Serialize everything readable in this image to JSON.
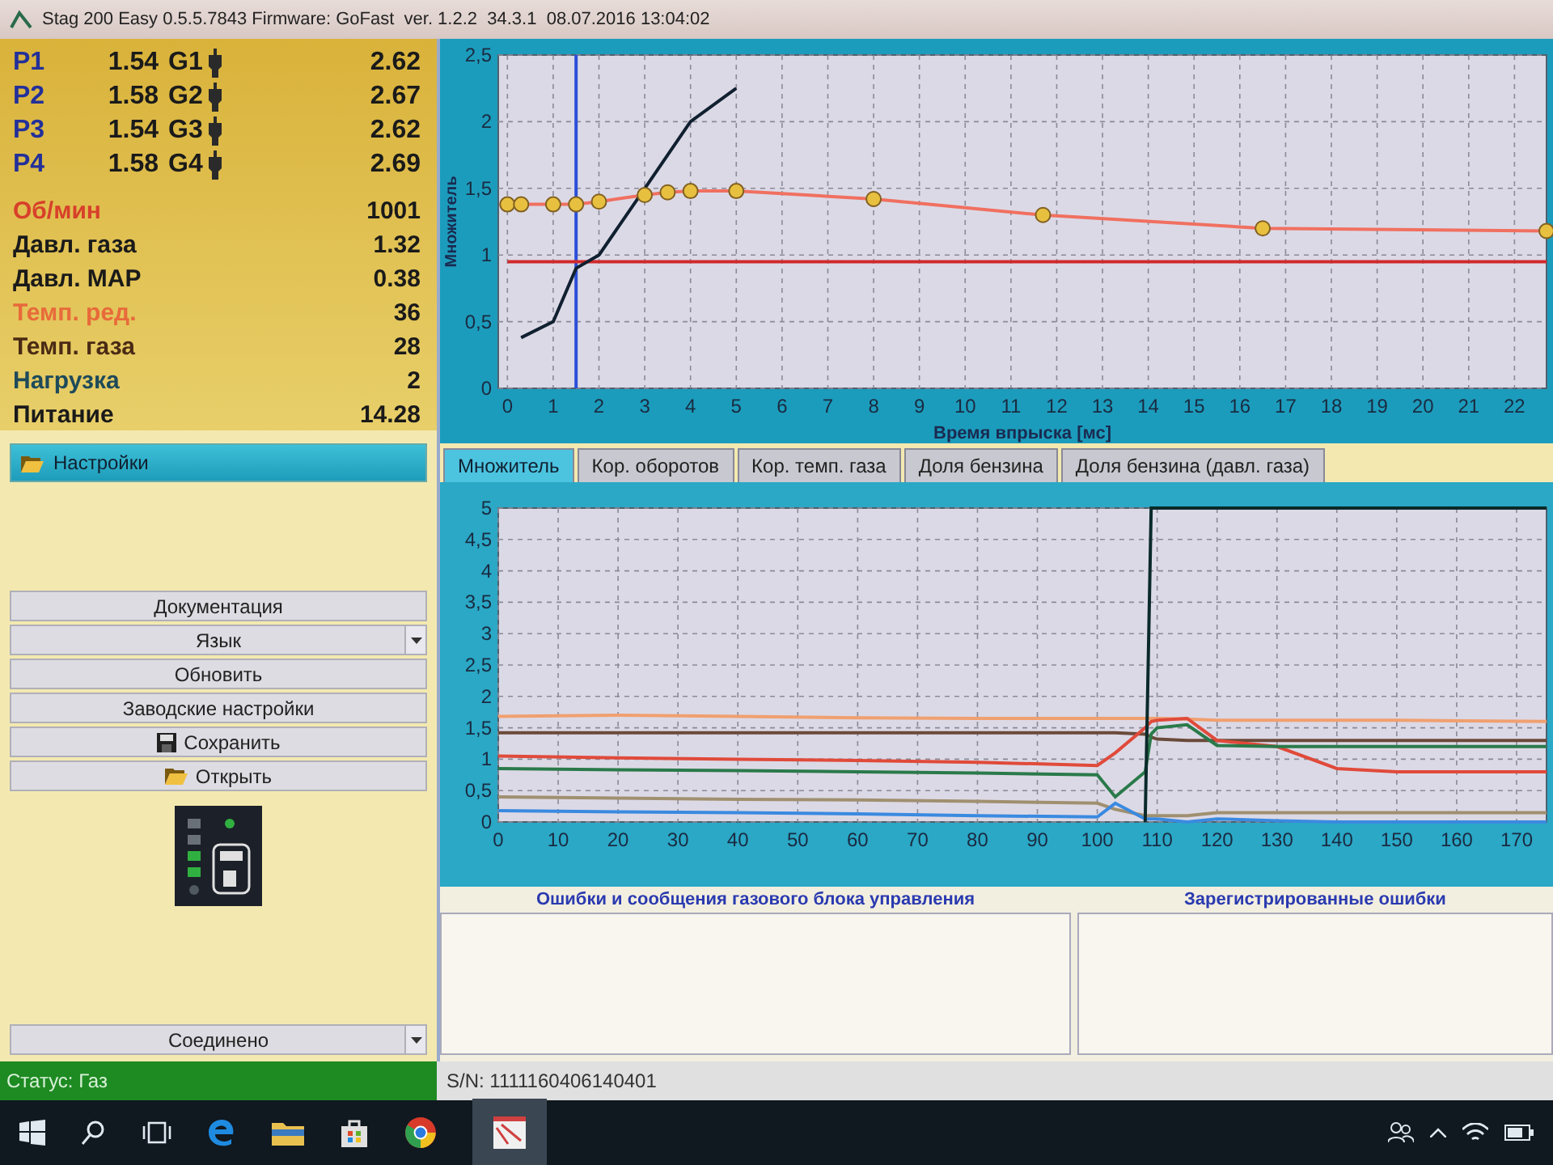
{
  "window": {
    "title": "Stag 200 Easy 0.5.5.7843 Firmware: GoFast  ver. 1.2.2  34.3.1  08.07.2016 13:04:02"
  },
  "injectors": [
    {
      "p_label": "P1",
      "p_value": "1.54",
      "g_label": "G1",
      "g_value": "2.62"
    },
    {
      "p_label": "P2",
      "p_value": "1.58",
      "g_label": "G2",
      "g_value": "2.67"
    },
    {
      "p_label": "P3",
      "p_value": "1.54",
      "g_label": "G3",
      "g_value": "2.62"
    },
    {
      "p_label": "P4",
      "p_value": "1.58",
      "g_label": "G4",
      "g_value": "2.69"
    }
  ],
  "readings": [
    {
      "label": "Об/мин",
      "value": "1001",
      "color": "#d8402a"
    },
    {
      "label": "Давл. газа",
      "value": "1.32",
      "color": "#1a1a1a"
    },
    {
      "label": "Давл. MAP",
      "value": "0.38",
      "color": "#1a1a1a"
    },
    {
      "label": "Темп. ред.",
      "value": "36",
      "color": "#e86a3a"
    },
    {
      "label": "Темп. газа",
      "value": "28",
      "color": "#4a2a14"
    },
    {
      "label": "Нагрузка",
      "value": "2",
      "color": "#1e4a5a"
    },
    {
      "label": "Питание",
      "value": "14.28",
      "color": "#1a1a1a"
    }
  ],
  "settings": {
    "title": "Настройки"
  },
  "buttons": [
    {
      "label": "Документация",
      "kind": "plain"
    },
    {
      "label": "Язык",
      "kind": "dropdown"
    },
    {
      "label": "Обновить",
      "kind": "plain"
    },
    {
      "label": "Заводские настройки",
      "kind": "plain"
    },
    {
      "label": "Сохранить",
      "kind": "save"
    },
    {
      "label": "Открыть",
      "kind": "open"
    }
  ],
  "connection": {
    "value": "Соединено"
  },
  "top_chart": {
    "chart_data": {
      "type": "line",
      "xlabel": "Время впрыска [мс]",
      "ylabel": "Множитель",
      "x": [
        0,
        0.3,
        1,
        1.5,
        2,
        3,
        3.5,
        4,
        5,
        8,
        11.7,
        16.5,
        22.7
      ],
      "series": [
        {
          "color": "#f07060",
          "marker": "circle",
          "values": [
            1.38,
            1.38,
            1.38,
            1.38,
            1.4,
            1.45,
            1.47,
            1.48,
            1.48,
            1.42,
            1.3,
            1.2,
            1.18
          ]
        },
        {
          "color": "#d02a2a",
          "values": [
            0.95,
            0.95,
            0.95,
            0.95,
            0.95,
            0.95,
            0.95,
            0.95,
            0.95,
            0.95,
            0.95,
            0.95,
            0.95
          ]
        },
        {
          "color": "#102030",
          "values": [
            null,
            0.38,
            0.5,
            0.9,
            1.0,
            1.5,
            1.75,
            2.0,
            2.25,
            null,
            null,
            null,
            null
          ]
        }
      ],
      "xlim": [
        -0.2,
        22.7
      ],
      "ylim": [
        0,
        2.5
      ],
      "grid": true,
      "xticks": [
        0,
        1,
        2,
        3,
        4,
        5,
        6,
        7,
        8,
        9,
        10,
        11,
        12,
        13,
        14,
        15,
        16,
        17,
        18,
        19,
        20,
        21,
        22
      ],
      "yticks": [
        0,
        {
          "value": 0.5,
          "label": "0,5"
        },
        1,
        {
          "value": 1.5,
          "label": "1,5"
        },
        2,
        {
          "value": 2.5,
          "label": "2,5"
        }
      ],
      "ref_lines": [
        {
          "axis": "x",
          "value": 1.5
        }
      ]
    }
  },
  "tabs": [
    {
      "label": "Множитель",
      "selected": true
    },
    {
      "label": "Кор. оборотов",
      "selected": false
    },
    {
      "label": "Кор. темп. газа",
      "selected": false
    },
    {
      "label": "Доля бензина",
      "selected": false
    },
    {
      "label": "Доля бензина (давл. газа)",
      "selected": false
    }
  ],
  "bottom_chart": {
    "chart_data": {
      "type": "line",
      "x": [
        0,
        20,
        40,
        60,
        80,
        100,
        103,
        108,
        109,
        110,
        115,
        120,
        130,
        140,
        150,
        175
      ],
      "series": [
        {
          "color": "#f0a070",
          "values": [
            1.68,
            1.7,
            1.68,
            1.66,
            1.65,
            1.65,
            1.65,
            1.65,
            1.65,
            1.65,
            1.64,
            1.62,
            1.62,
            1.62,
            1.62,
            1.6
          ]
        },
        {
          "color": "#6a4a3a",
          "values": [
            1.42,
            1.42,
            1.42,
            1.42,
            1.42,
            1.42,
            1.42,
            1.4,
            1.35,
            1.32,
            1.3,
            1.3,
            1.3,
            1.3,
            1.3,
            1.3
          ]
        },
        {
          "color": "#e04a3a",
          "values": [
            1.05,
            1.02,
            1.0,
            0.98,
            0.95,
            0.9,
            1.1,
            1.5,
            1.6,
            1.62,
            1.65,
            1.3,
            1.2,
            0.85,
            0.8,
            0.8
          ]
        },
        {
          "color": "#2a7a4a",
          "values": [
            0.85,
            0.83,
            0.82,
            0.8,
            0.78,
            0.75,
            0.4,
            0.8,
            1.4,
            1.5,
            1.55,
            1.22,
            1.2,
            1.2,
            1.2,
            1.2
          ]
        },
        {
          "color": "#a09070",
          "values": [
            0.4,
            0.38,
            0.36,
            0.35,
            0.33,
            0.3,
            0.2,
            0.1,
            0.1,
            0.1,
            0.1,
            0.15,
            0.15,
            0.15,
            0.15,
            0.15
          ]
        },
        {
          "color": "#3a8ae0",
          "values": [
            0.18,
            0.16,
            0.15,
            0.13,
            0.1,
            0.08,
            0.3,
            0.05,
            0.05,
            0.05,
            0.0,
            0.05,
            0.02,
            0.0,
            0.0,
            0.0
          ]
        },
        {
          "color": "#0a2a2a",
          "values": [
            null,
            null,
            null,
            null,
            null,
            null,
            null,
            0,
            5,
            5,
            5,
            5,
            5,
            5,
            5,
            5
          ]
        }
      ],
      "xlim": [
        0,
        175
      ],
      "ylim": [
        0,
        5
      ],
      "grid": true,
      "xticks": [
        0,
        10,
        20,
        30,
        40,
        50,
        60,
        70,
        80,
        90,
        100,
        110,
        120,
        130,
        140,
        150,
        160,
        170
      ],
      "yticks": [
        0,
        {
          "value": 0.5,
          "label": "0,5"
        },
        1,
        {
          "value": 1.5,
          "label": "1,5"
        },
        2,
        {
          "value": 2.5,
          "label": "2,5"
        },
        3,
        {
          "value": 3.5,
          "label": "3,5"
        },
        4,
        {
          "value": 4.5,
          "label": "4,5"
        },
        5
      ]
    }
  },
  "errors": {
    "ecu_title": "Ошибки и сообщения газового блока управления",
    "logged_title": "Зарегистрированные ошибки"
  },
  "status_bar": {
    "status": "Статус: Газ",
    "serial": "S/N: 1111160406140401"
  }
}
